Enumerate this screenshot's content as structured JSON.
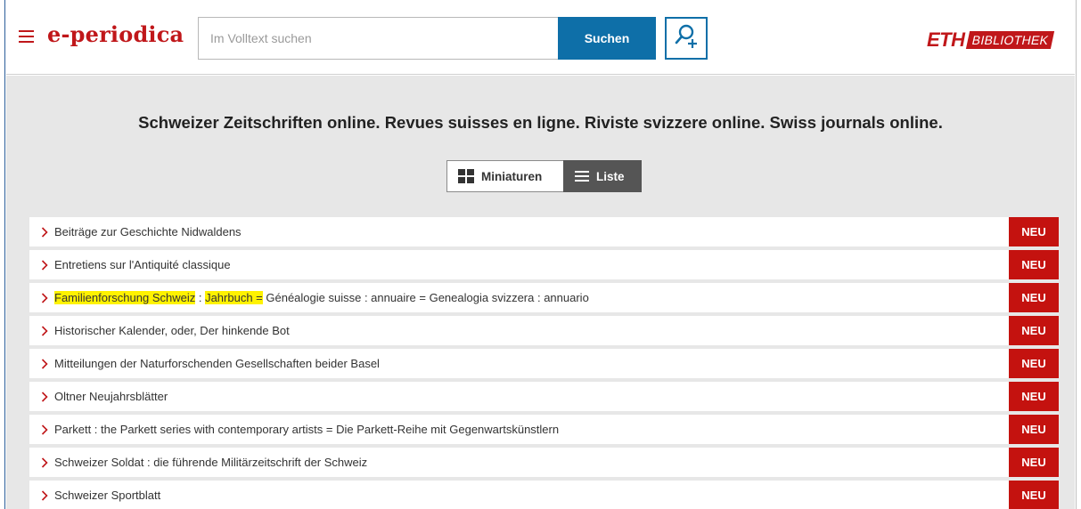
{
  "header": {
    "logo": "e-periodica",
    "search_placeholder": "Im Volltext suchen",
    "search_button": "Suchen",
    "eth_mark": "ETH",
    "eth_library": "BIBLIOTHEK"
  },
  "main": {
    "tagline": "Schweizer Zeitschriften online. Revues suisses en ligne. Riviste svizzere online. Swiss journals online.",
    "view_toggle": {
      "grid_label": "Miniaturen",
      "list_label": "Liste"
    }
  },
  "journals": [
    {
      "title": "Beiträge zur Geschichte Nidwaldens",
      "badge": "NEU"
    },
    {
      "title": "Entretiens sur l'Antiquité classique",
      "badge": "NEU"
    },
    {
      "title_parts": [
        "Familienforschung Schweiz",
        " : ",
        "Jahrbuch =",
        " Généalogie suisse : annuaire = Genealogia svizzera : annuario"
      ],
      "badge": "NEU"
    },
    {
      "title": "Historischer Kalender, oder, Der hinkende Bot",
      "badge": "NEU"
    },
    {
      "title": "Mitteilungen der Naturforschenden Gesellschaften beider Basel",
      "badge": "NEU"
    },
    {
      "title": "Oltner Neujahrsblätter",
      "badge": "NEU"
    },
    {
      "title": "Parkett : the Parkett series with contemporary artists = Die Parkett-Reihe mit Gegenwartskünstlern",
      "badge": "NEU"
    },
    {
      "title": "Schweizer Soldat : die führende Militärzeitschrift der Schweiz",
      "badge": "NEU"
    },
    {
      "title": "Schweizer Sportblatt",
      "badge": "NEU"
    }
  ],
  "colors": {
    "brand_red": "#c0171a",
    "search_blue": "#0e6fa8",
    "highlight": "#fff200",
    "badge_red": "#c4120f"
  }
}
